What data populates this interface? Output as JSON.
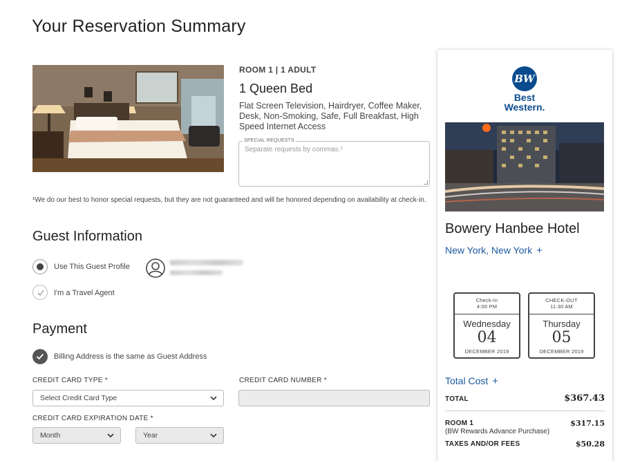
{
  "page": {
    "title": "Your Reservation Summary"
  },
  "room": {
    "heading": "ROOM 1 | 1 ADULT",
    "type": "1 Queen Bed",
    "amenities": "Flat Screen Television, Hairdryer, Coffee Maker, Desk, Non-Smoking, Safe, Full Breakfast, High Speed Internet Access",
    "special_requests_label": "SPECIAL REQUESTS",
    "special_requests_placeholder": "Separate requests by commas.¹",
    "special_requests_value": ""
  },
  "disclaimer": "¹We do our best to honor special requests, but they are not guaranteed and will be honored depending on availability at check-in.",
  "guest": {
    "title": "Guest Information",
    "use_profile_label": "Use This Guest Profile",
    "travel_agent_label": "I'm a Travel Agent",
    "use_profile_selected": true
  },
  "payment": {
    "title": "Payment",
    "billing_same_label": "Billing Address is the same as Guest Address",
    "card_type_label": "CREDIT CARD TYPE *",
    "card_type_value": "Select Credit Card Type",
    "card_number_label": "CREDIT CARD NUMBER *",
    "card_number_value": "",
    "expiration_label": "CREDIT CARD EXPIRATION DATE *",
    "month_value": "Month",
    "year_value": "Year"
  },
  "hotel": {
    "brand_mark": "BW",
    "brand_line1": "Best",
    "brand_line2": "Western.",
    "name": "Bowery Hanbee Hotel",
    "city": "New York, New York",
    "plus": "+"
  },
  "stay": {
    "checkin": {
      "label": "Check-In",
      "time": "4:00 PM",
      "weekday": "Wednesday",
      "day": "04",
      "month": "DECEMBER 2019"
    },
    "checkout": {
      "label": "CHECK-OUT",
      "time": "11:30 AM",
      "weekday": "Thursday",
      "day": "05",
      "month": "DECEMBER 2019"
    }
  },
  "cost": {
    "title": "Total Cost",
    "plus": "+",
    "total_label": "TOTAL",
    "total_value": "$367.43",
    "room_label": "ROOM 1",
    "room_sub": "(BW Rewards Advance Purchase)",
    "room_value": "$317.15",
    "taxes_label": "TAXES AND/OR FEES",
    "taxes_value": "$50.28"
  },
  "colors": {
    "link": "#1d5aa0",
    "brand": "#0a4b8e",
    "text": "#222222"
  }
}
